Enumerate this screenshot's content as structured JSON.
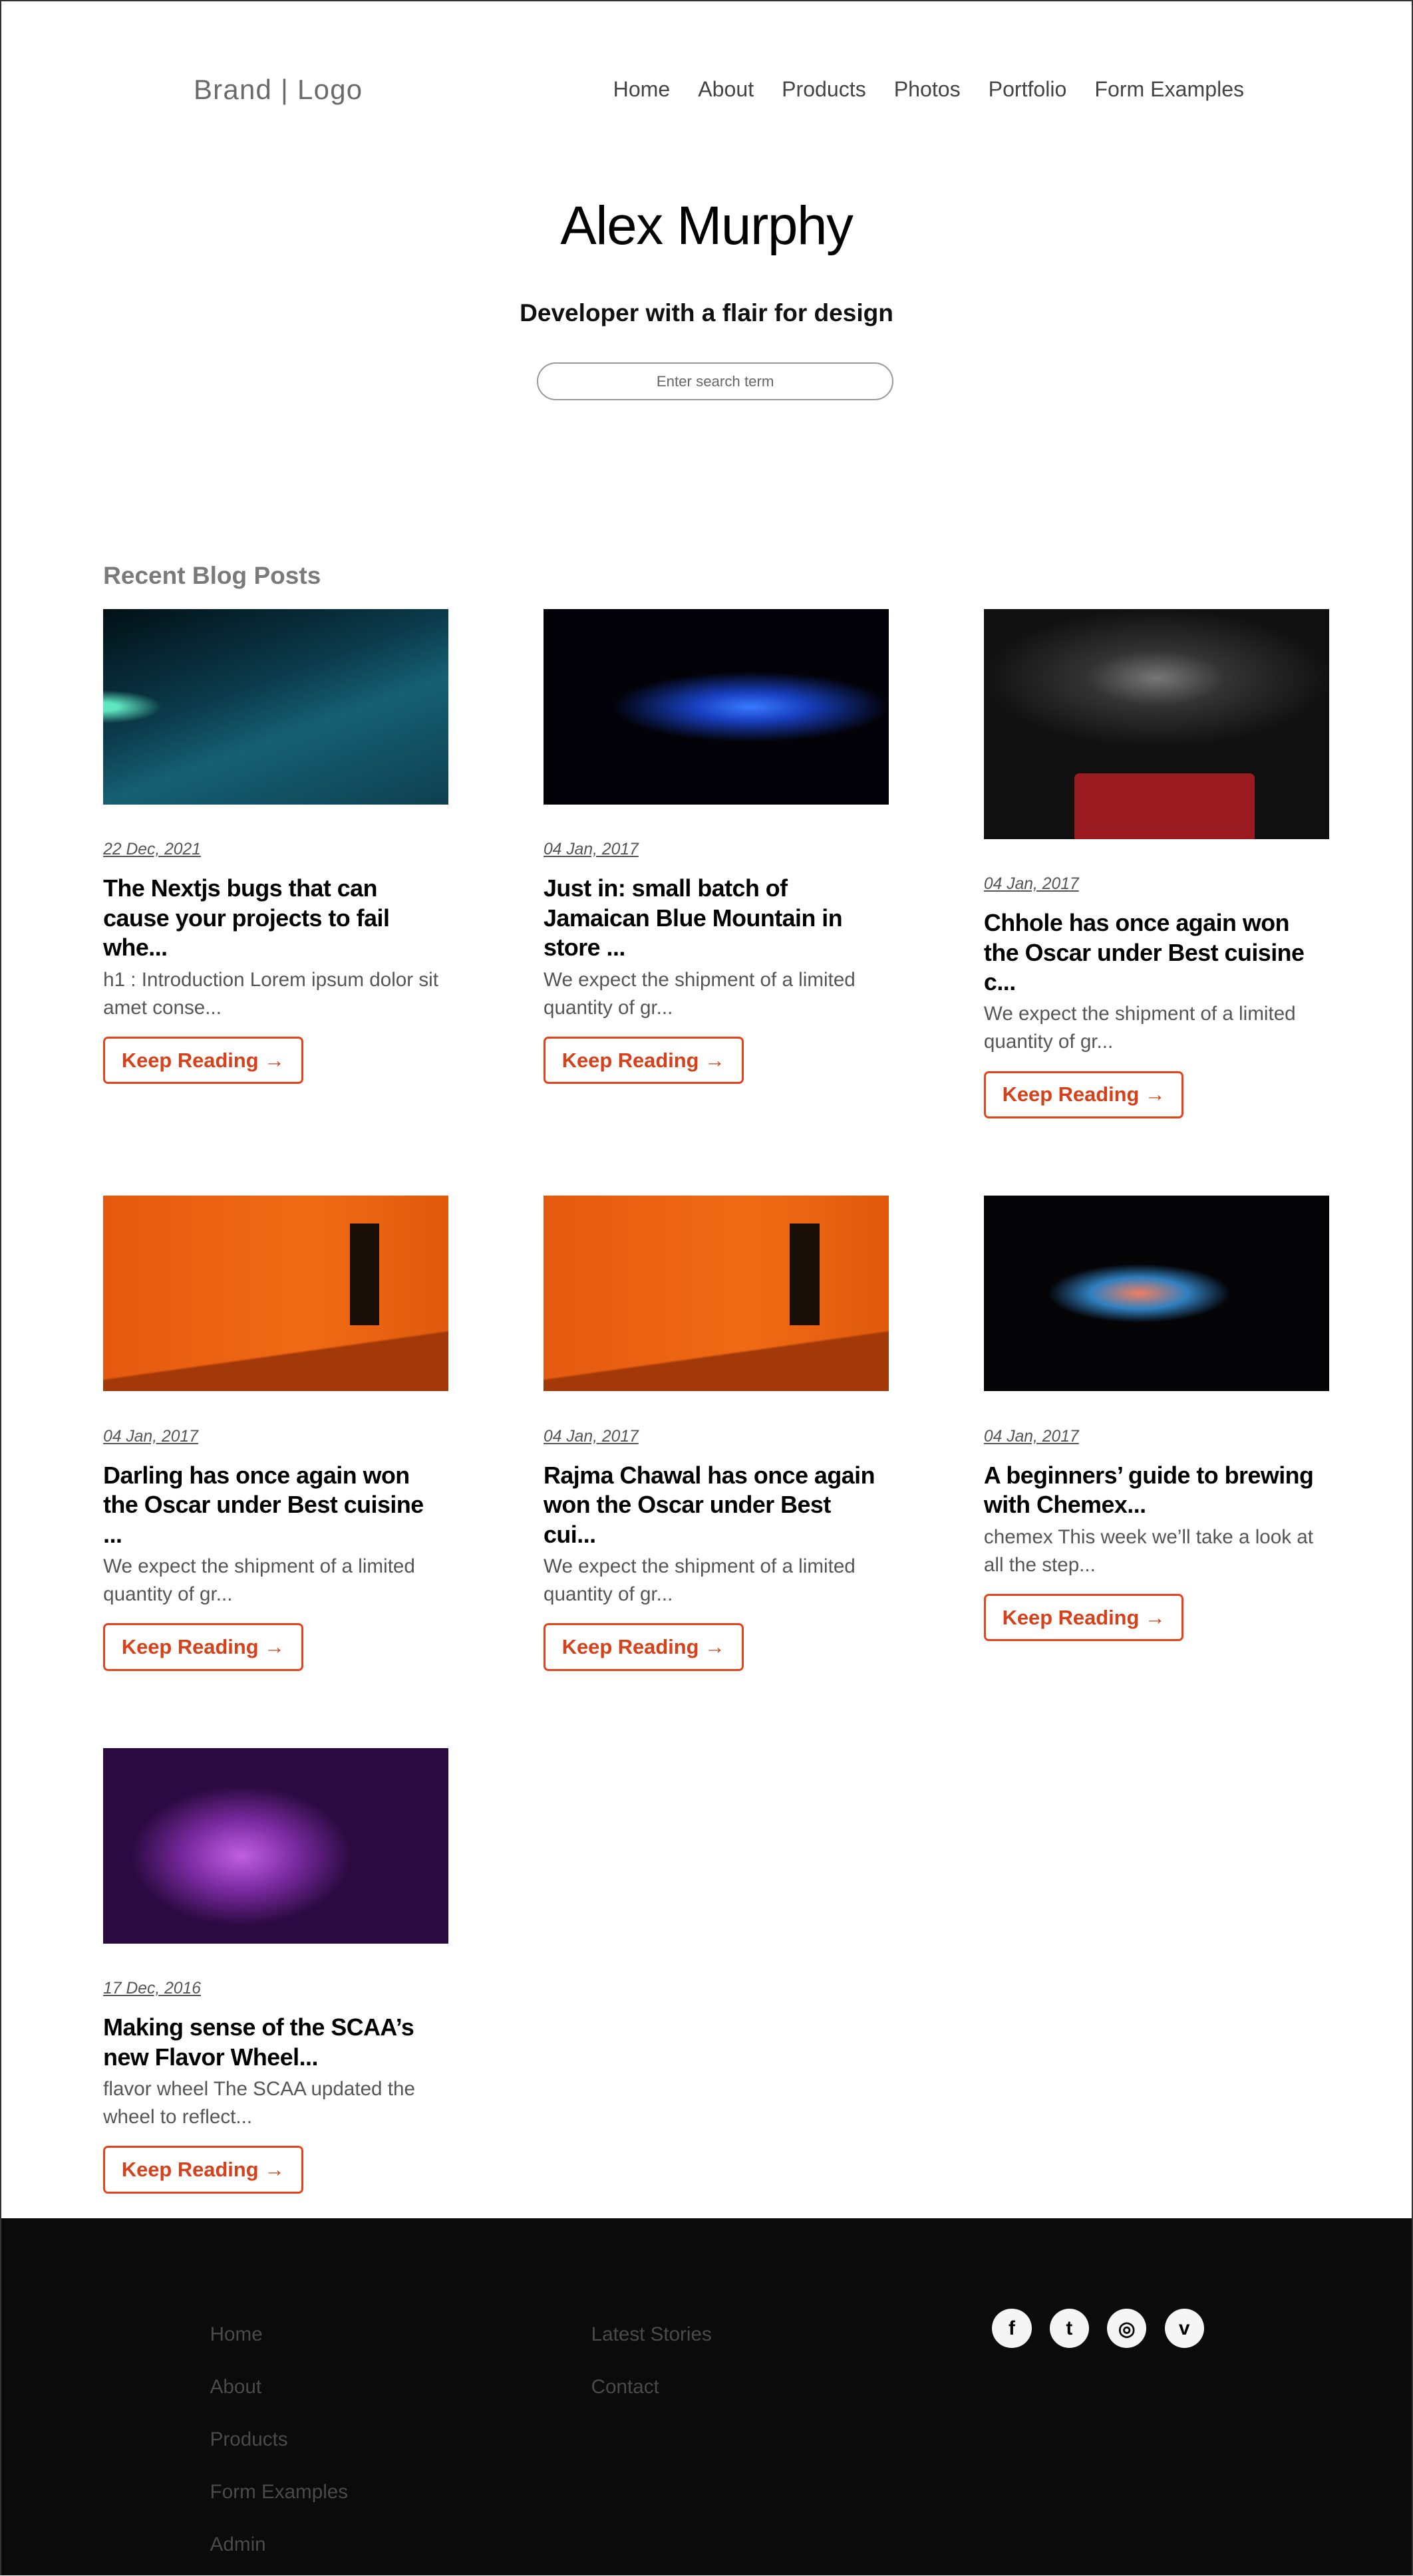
{
  "header": {
    "brand": "Brand | Logo",
    "nav": [
      "Home",
      "About",
      "Products",
      "Photos",
      "Portfolio",
      "Form Examples"
    ]
  },
  "hero": {
    "title": "Alex Murphy",
    "subtitle": "Developer with a flair for design",
    "search_placeholder": "Enter search term"
  },
  "blog": {
    "section_title": "Recent Blog Posts",
    "button_label": "Keep Reading →",
    "posts": [
      {
        "date": "22 Dec, 2021",
        "title": "The Nextjs bugs that can cause your projects to fail whe...",
        "excerpt": "h1 : Introduction Lorem ipsum dolor sit amet conse..."
      },
      {
        "date": "04 Jan, 2017",
        "title": "Just in: small batch of Jamaican Blue Mountain in store ...",
        "excerpt": "We expect the shipment of a limited quantity of gr..."
      },
      {
        "date": "04 Jan, 2017",
        "title": "Chhole has once again won the Oscar under Best cuisine c...",
        "excerpt": "We expect the shipment of a limited quantity of gr..."
      },
      {
        "date": "04 Jan, 2017",
        "title": "Darling has once again won the Oscar under Best cuisine ...",
        "excerpt": "We expect the shipment of a limited quantity of gr..."
      },
      {
        "date": "04 Jan, 2017",
        "title": "Rajma Chawal has once again won the Oscar under Best cui...",
        "excerpt": "We expect the shipment of a limited quantity of gr..."
      },
      {
        "date": "04 Jan, 2017",
        "title": "A beginners’ guide to brewing with Chemex...",
        "excerpt": "chemex This week we’ll take a look at all the step..."
      },
      {
        "date": "17 Dec, 2016",
        "title": "Making sense of the SCAA’s new Flavor Wheel...",
        "excerpt": "flavor wheel The SCAA updated the wheel to reflect..."
      }
    ]
  },
  "footer": {
    "col1": [
      "Home",
      "About",
      "Products",
      "Form Examples",
      "Admin"
    ],
    "col2": [
      "Latest Stories",
      "Contact"
    ],
    "social": [
      {
        "icon": "facebook-icon",
        "glyph": "f"
      },
      {
        "icon": "twitter-icon",
        "glyph": "t"
      },
      {
        "icon": "instagram-icon",
        "glyph": "◎"
      },
      {
        "icon": "vimeo-icon",
        "glyph": "v"
      }
    ]
  },
  "colors": {
    "accent": "#e8421a",
    "footer_bg": "#0b0b0b"
  }
}
